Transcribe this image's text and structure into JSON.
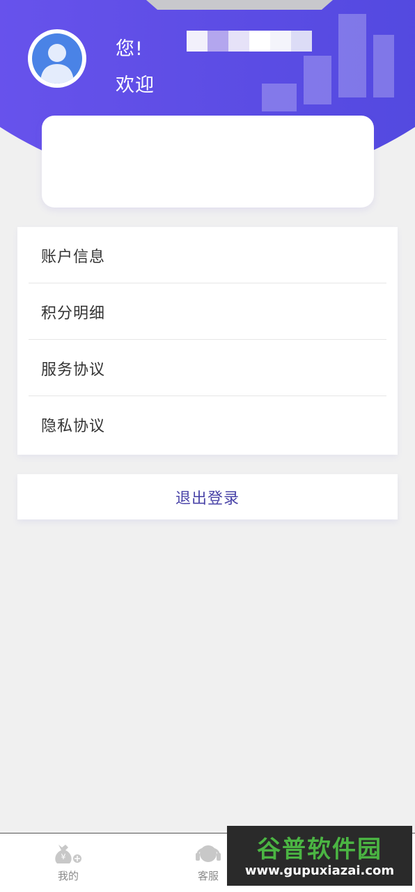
{
  "header": {
    "greeting_line1": "您!",
    "greeting_line2": "欢迎",
    "gradient_colors": [
      "#6f57f2",
      "#4b46dc"
    ]
  },
  "menu": {
    "items": [
      {
        "label": "账户信息"
      },
      {
        "label": "积分明细"
      },
      {
        "label": "服务协议"
      },
      {
        "label": "隐私协议"
      }
    ]
  },
  "logout": {
    "label": "退出登录",
    "color": "#4a44a8"
  },
  "tabbar": {
    "tabs": [
      {
        "label": "我的",
        "icon": "money-bag-icon"
      },
      {
        "label": "客服",
        "icon": "headset-icon"
      }
    ]
  },
  "watermark": {
    "title": "谷普软件园",
    "url": "www.gupuxiazai.com"
  }
}
